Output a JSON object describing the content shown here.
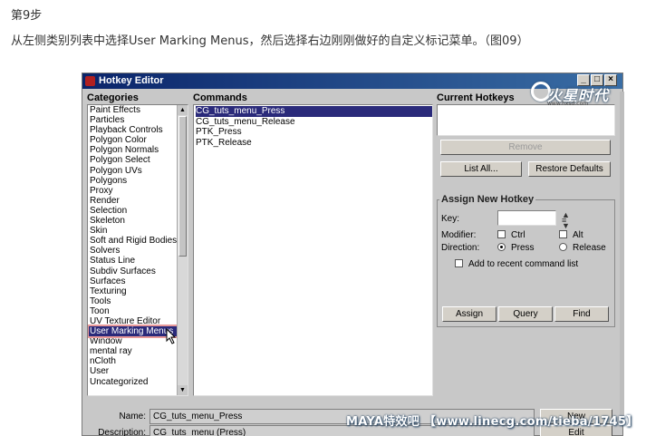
{
  "article": {
    "step": "第9步",
    "description": "从左侧类别列表中选择User Marking Menus，然后选择右边刚刚做好的自定义标记菜单。（图09）"
  },
  "window": {
    "title": "Hotkey Editor",
    "controls": [
      "_",
      "□",
      "×"
    ]
  },
  "categories": {
    "label": "Categories",
    "items": [
      "Paint Effects",
      "Particles",
      "Playback Controls",
      "Polygon Color",
      "Polygon Normals",
      "Polygon Select",
      "Polygon UVs",
      "Polygons",
      "Proxy",
      "Render",
      "Selection",
      "Skeleton",
      "Skin",
      "Soft and Rigid Bodies",
      "Solvers",
      "Status Line",
      "Subdiv Surfaces",
      "Surfaces",
      "Texturing",
      "Tools",
      "Toon",
      "UV Texture Editor",
      "User Marking Menus",
      "Window",
      "mental ray",
      "nCloth",
      "User",
      "Uncategorized"
    ],
    "selected": "User Marking Menus",
    "scroll_up": "▲",
    "scroll_down": "▼"
  },
  "commands": {
    "label": "Commands",
    "items": [
      "CG_tuts_menu_Press",
      "CG_tuts_menu_Release",
      "PTK_Press",
      "PTK_Release"
    ],
    "selected": "CG_tuts_menu_Press"
  },
  "current_hotkeys": {
    "label": "Current Hotkeys",
    "remove": "Remove",
    "list_all": "List All...",
    "restore_defaults": "Restore Defaults"
  },
  "assign": {
    "label": "Assign New Hotkey",
    "key_label": "Key:",
    "key_value": "",
    "modifier_label": "Modifier:",
    "ctrl": "Ctrl",
    "alt": "Alt",
    "direction_label": "Direction:",
    "press": "Press",
    "release": "Release",
    "recent": "Add to recent command list",
    "assign_btn": "Assign",
    "query_btn": "Query",
    "find_btn": "Find"
  },
  "bottom": {
    "name_label": "Name:",
    "name_value": "CG_tuts_menu_Press",
    "desc_label": "Description:",
    "desc_value": "CG_tuts_menu (Press)",
    "new_btn": "New",
    "edit_btn": "Edit"
  },
  "logo": {
    "text": "火星时代",
    "sub": "www.hxsd.com"
  },
  "watermark": "MAYA特效吧 【www.linecg.com/tieba/1745】"
}
